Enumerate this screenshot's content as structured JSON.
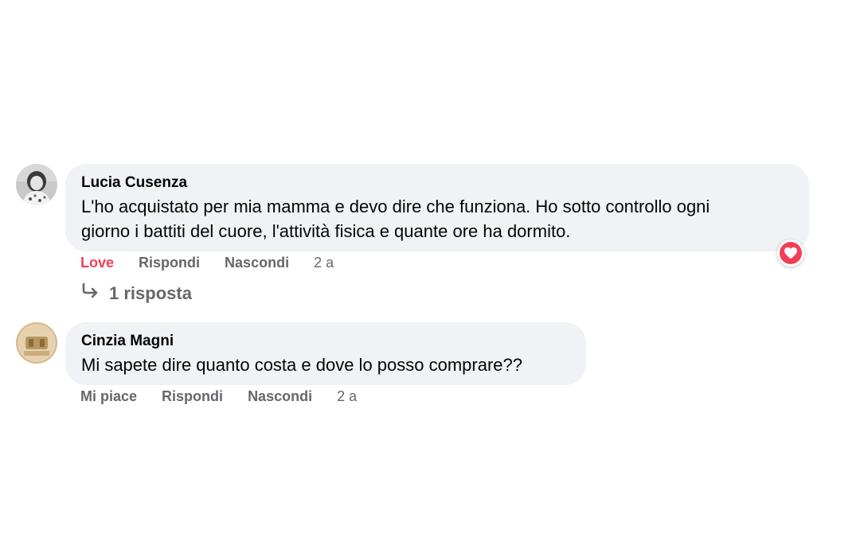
{
  "comments": [
    {
      "author": "Lucia Cusenza",
      "text": "L'ho acquistato per mia mamma e devo dire che funziona. Ho sotto controllo ogni giorno i battiti del cuore, l'attività fisica e quante ore ha dormito.",
      "text_line1": "L'ho acquistato per mia mamma e devo dire che funziona. Ho sotto controllo ogni",
      "text_line2": "giorno i battiti del cuore, l'attività fisica e quante ore ha dormito.",
      "reaction_label": "Love",
      "reply_label": "Rispondi",
      "hide_label": "Nascondi",
      "time": "2 a",
      "reaction_icon": "love-heart-icon",
      "replies_label": "1 risposta"
    },
    {
      "author": "Cinzia Magni",
      "text": "Mi sapete dire quanto costa e dove lo posso comprare??",
      "reaction_label": "Mi piace",
      "reply_label": "Rispondi",
      "hide_label": "Nascondi",
      "time": "2 a"
    }
  ],
  "colors": {
    "bubble": "#f0f2f5",
    "love": "#f33e58",
    "meta": "#65676b",
    "text": "#050505"
  }
}
